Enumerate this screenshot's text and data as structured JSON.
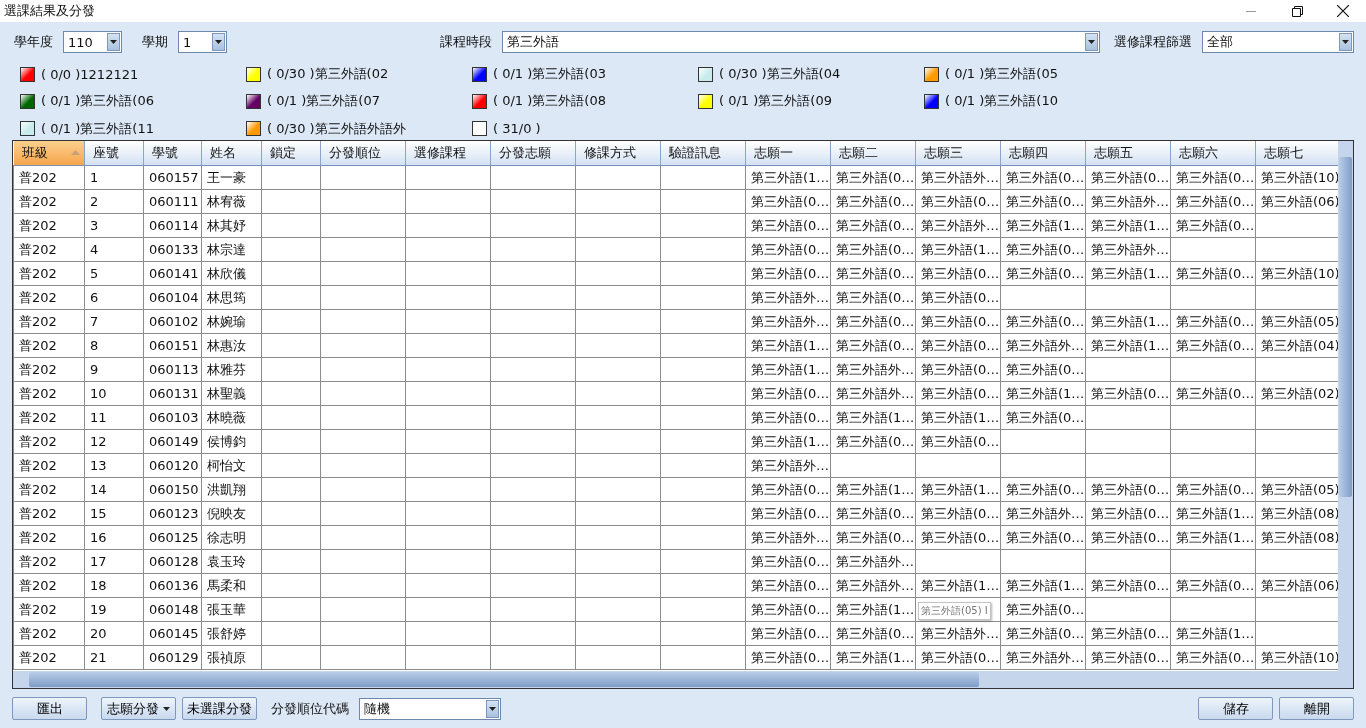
{
  "window": {
    "title": "選課結果及分發"
  },
  "filters": {
    "year": {
      "label": "學年度",
      "value": "110"
    },
    "term": {
      "label": "學期",
      "value": "1"
    },
    "period": {
      "label": "課程時段",
      "value": "第三外語"
    },
    "course_filter": {
      "label": "選修課程篩選",
      "value": "全部"
    }
  },
  "legend": [
    {
      "label": "( 0/0 )1212121",
      "color": "#ff0000"
    },
    {
      "label": "( 0/30 )第三外語(02",
      "color": "#ffff00"
    },
    {
      "label": "( 0/1 )第三外語(03",
      "color": "#0000ff"
    },
    {
      "label": "( 0/30 )第三外語(04",
      "color": "#c8ecec"
    },
    {
      "label": "( 0/1 )第三外語(05",
      "color": "#ff9900"
    },
    {
      "label": "( 0/1 )第三外語(06",
      "color": "#006600"
    },
    {
      "label": "( 0/1 )第三外語(07",
      "color": "#660066"
    },
    {
      "label": "( 0/1 )第三外語(08",
      "color": "#ff0000"
    },
    {
      "label": "( 0/1 )第三外語(09",
      "color": "#ffff00"
    },
    {
      "label": "( 0/1 )第三外語(10",
      "color": "#0000ff"
    },
    {
      "label": "( 0/1 )第三外語(11",
      "color": "#c8ecec"
    },
    {
      "label": "( 0/30 )第三外語外語外",
      "color": "#ff9900"
    },
    {
      "label": "( 31/0 )",
      "color": "#ffffff"
    }
  ],
  "table": {
    "columns": [
      {
        "label": "班級",
        "sorted": true
      },
      {
        "label": "座號",
        "sorted": false
      },
      {
        "label": "學號",
        "sorted": false
      },
      {
        "label": "姓名",
        "sorted": false
      },
      {
        "label": "鎖定",
        "sorted": false
      },
      {
        "label": "分發順位",
        "sorted": false
      },
      {
        "label": "選修課程",
        "sorted": false
      },
      {
        "label": "分發志願",
        "sorted": false
      },
      {
        "label": "修課方式",
        "sorted": false
      },
      {
        "label": "驗證訊息",
        "sorted": false
      },
      {
        "label": "志願一",
        "sorted": false
      },
      {
        "label": "志願二",
        "sorted": false
      },
      {
        "label": "志願三",
        "sorted": false
      },
      {
        "label": "志願四",
        "sorted": false
      },
      {
        "label": "志願五",
        "sorted": false
      },
      {
        "label": "志願六",
        "sorted": false
      },
      {
        "label": "志願七",
        "sorted": false
      }
    ],
    "rows": [
      {
        "class": "普202",
        "seat": "1",
        "id": "060157",
        "name": "王一豪",
        "choices": [
          "第三外語(1…",
          "第三外語(0…",
          "第三外語外…",
          "第三外語(0…",
          "第三外語(0…",
          "第三外語(0…",
          "第三外語(10)"
        ]
      },
      {
        "class": "普202",
        "seat": "2",
        "id": "060111",
        "name": "林宥薇",
        "choices": [
          "第三外語(0…",
          "第三外語(0…",
          "第三外語(0…",
          "第三外語(0…",
          "第三外語外…",
          "第三外語(0…",
          "第三外語(06)"
        ]
      },
      {
        "class": "普202",
        "seat": "3",
        "id": "060114",
        "name": "林其妤",
        "choices": [
          "第三外語(0…",
          "第三外語(0…",
          "第三外語外…",
          "第三外語(1…",
          "第三外語(1…",
          "第三外語(0…"
        ]
      },
      {
        "class": "普202",
        "seat": "4",
        "id": "060133",
        "name": "林宗達",
        "choices": [
          "第三外語(0…",
          "第三外語(0…",
          "第三外語(1…",
          "第三外語(0…",
          "第三外語外…"
        ]
      },
      {
        "class": "普202",
        "seat": "5",
        "id": "060141",
        "name": "林欣儀",
        "choices": [
          "第三外語(0…",
          "第三外語(0…",
          "第三外語(0…",
          "第三外語(0…",
          "第三外語(1…",
          "第三外語(0…",
          "第三外語(10)"
        ]
      },
      {
        "class": "普202",
        "seat": "6",
        "id": "060104",
        "name": "林思筠",
        "choices": [
          "第三外語外…",
          "第三外語(0…",
          "第三外語(0…"
        ]
      },
      {
        "class": "普202",
        "seat": "7",
        "id": "060102",
        "name": "林婉瑜",
        "choices": [
          "第三外語外…",
          "第三外語(0…",
          "第三外語(0…",
          "第三外語(0…",
          "第三外語(1…",
          "第三外語(0…",
          "第三外語(05)"
        ]
      },
      {
        "class": "普202",
        "seat": "8",
        "id": "060151",
        "name": "林惠汝",
        "choices": [
          "第三外語(1…",
          "第三外語(0…",
          "第三外語(0…",
          "第三外語外…",
          "第三外語(1…",
          "第三外語(0…",
          "第三外語(04)"
        ]
      },
      {
        "class": "普202",
        "seat": "9",
        "id": "060113",
        "name": "林雅芬",
        "choices": [
          "第三外語(1…",
          "第三外語外…",
          "第三外語(0…",
          "第三外語(0…"
        ]
      },
      {
        "class": "普202",
        "seat": "10",
        "id": "060131",
        "name": "林聖義",
        "choices": [
          "第三外語(0…",
          "第三外語外…",
          "第三外語(0…",
          "第三外語(1…",
          "第三外語(0…",
          "第三外語(0…",
          "第三外語(02)"
        ]
      },
      {
        "class": "普202",
        "seat": "11",
        "id": "060103",
        "name": "林曉薇",
        "choices": [
          "第三外語(0…",
          "第三外語(1…",
          "第三外語(1…",
          "第三外語(0…"
        ]
      },
      {
        "class": "普202",
        "seat": "12",
        "id": "060149",
        "name": "侯博鈞",
        "choices": [
          "第三外語(1…",
          "第三外語(0…",
          "第三外語(0…"
        ]
      },
      {
        "class": "普202",
        "seat": "13",
        "id": "060120",
        "name": "柯怡文",
        "choices": [
          "第三外語外…"
        ]
      },
      {
        "class": "普202",
        "seat": "14",
        "id": "060150",
        "name": "洪凱翔",
        "choices": [
          "第三外語(0…",
          "第三外語(1…",
          "第三外語(1…",
          "第三外語(0…",
          "第三外語(0…",
          "第三外語(0…",
          "第三外語(05)"
        ]
      },
      {
        "class": "普202",
        "seat": "15",
        "id": "060123",
        "name": "倪映友",
        "choices": [
          "第三外語(0…",
          "第三外語(0…",
          "第三外語(0…",
          "第三外語外…",
          "第三外語(0…",
          "第三外語(1…",
          "第三外語(08)"
        ]
      },
      {
        "class": "普202",
        "seat": "16",
        "id": "060125",
        "name": "徐志明",
        "choices": [
          "第三外語外…",
          "第三外語(0…",
          "第三外語(0…",
          "第三外語(0…",
          "第三外語(0…",
          "第三外語(1…",
          "第三外語(08)"
        ]
      },
      {
        "class": "普202",
        "seat": "17",
        "id": "060128",
        "name": "袁玉玲",
        "choices": [
          "第三外語(0…",
          "第三外語外…"
        ]
      },
      {
        "class": "普202",
        "seat": "18",
        "id": "060136",
        "name": "馬柔和",
        "choices": [
          "第三外語(0…",
          "第三外語外…",
          "第三外語(1…",
          "第三外語(1…",
          "第三外語(0…",
          "第三外語(0…",
          "第三外語(06)"
        ]
      },
      {
        "class": "普202",
        "seat": "19",
        "id": "060148",
        "name": "張玉華",
        "choices": [
          "第三外語(0…",
          "第三外語(1…"
        ],
        "tooltip": "第三外語(05) I",
        "choices_after_tooltip": [
          "第三外語(0…"
        ]
      },
      {
        "class": "普202",
        "seat": "20",
        "id": "060145",
        "name": "張舒婷",
        "choices": [
          "第三外語(0…",
          "第三外語(0…",
          "第三外語外…",
          "第三外語(0…",
          "第三外語(0…",
          "第三外語(1…"
        ]
      },
      {
        "class": "普202",
        "seat": "21",
        "id": "060129",
        "name": "張禎原",
        "choices": [
          "第三外語(0…",
          "第三外語(1…",
          "第三外語(0…",
          "第三外語外…",
          "第三外語(0…",
          "第三外語(0…",
          "第三外語(10)"
        ]
      }
    ]
  },
  "footer": {
    "export": "匯出",
    "assign_by_choice": "志願分發",
    "assign_unselected": "未選課分發",
    "order_label": "分發順位代碼",
    "order_value": "隨機",
    "save": "儲存",
    "exit": "離開"
  }
}
